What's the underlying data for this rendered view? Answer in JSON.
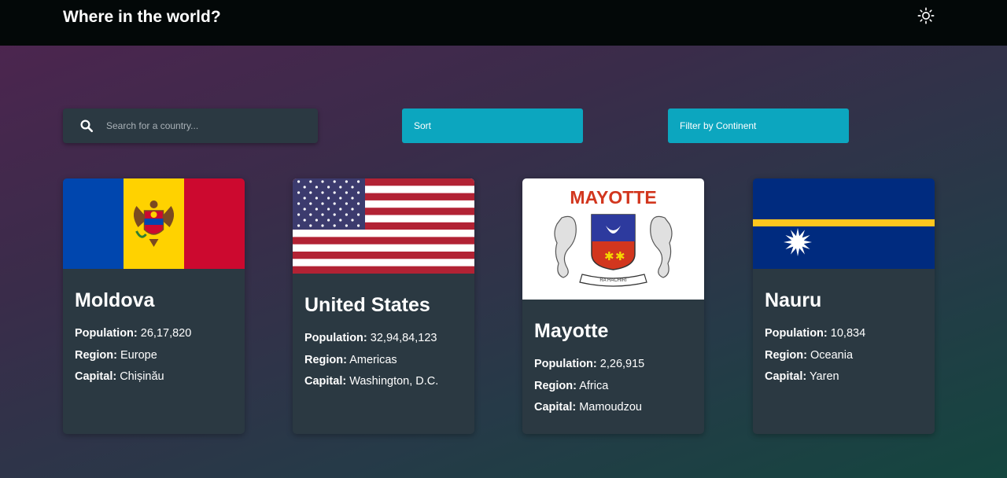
{
  "header": {
    "title": "Where in the world?",
    "theme_icon": "sun-icon"
  },
  "controls": {
    "search_placeholder": "Search for a country...",
    "search_icon": "search-icon",
    "sort_label": "Sort",
    "filter_label": "Filter by Continent"
  },
  "labels": {
    "population": "Population:",
    "region": "Region:",
    "capital": "Capital:"
  },
  "countries": [
    {
      "name": "Moldova",
      "population": "26,17,820",
      "region": "Europe",
      "capital": "Chișinău",
      "flag": "moldova-flag"
    },
    {
      "name": "United States",
      "population": "32,94,84,123",
      "region": "Americas",
      "capital": "Washington, D.C.",
      "flag": "us-flag"
    },
    {
      "name": "Mayotte",
      "population": "2,26,915",
      "region": "Africa",
      "capital": "Mamoudzou",
      "flag": "mayotte-flag",
      "flag_text": "MAYOTTE",
      "flag_motto": "RA HACHIRI"
    },
    {
      "name": "Nauru",
      "population": "10,834",
      "region": "Oceania",
      "capital": "Yaren",
      "flag": "nauru-flag"
    }
  ],
  "colors": {
    "header_bg": "#030808",
    "card_bg": "#2b3942",
    "accent": "#0ca6bf"
  }
}
